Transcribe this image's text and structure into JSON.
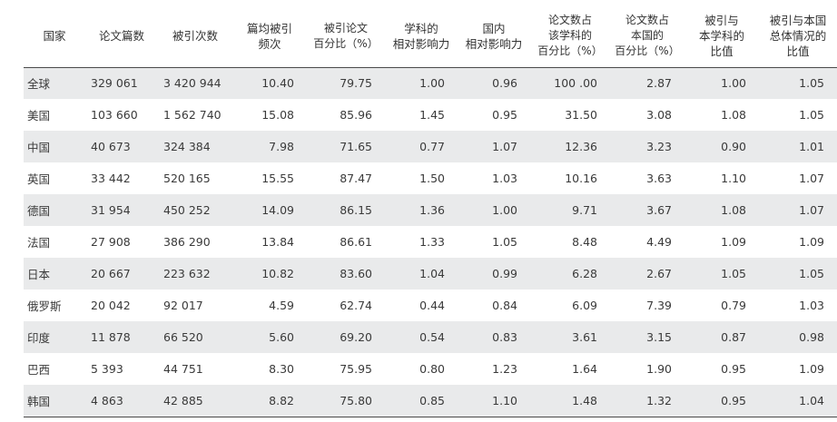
{
  "table": {
    "headers": [
      "国家",
      "论文篇数",
      "被引次数",
      "篇均被引\n频次",
      "被引论文\n百分比（%）",
      "学科的\n相对影响力",
      "国内\n相对影响力",
      "论文数占\n该学科的\n百分比（%）",
      "论文数占\n本国的\n百分比（%）",
      "被引与\n本学科的\n比值",
      "被引与本国\n总体情况的\n比值"
    ],
    "rows": [
      [
        "全球",
        "329 061",
        "3 420 944",
        "10.40",
        "79.75",
        "1.00",
        "0.96",
        "100 .00",
        "2.87",
        "1.00",
        "1.05"
      ],
      [
        "美国",
        "103 660",
        "1 562 740",
        "15.08",
        "85.96",
        "1.45",
        "0.95",
        "31.50",
        "3.08",
        "1.08",
        "1.05"
      ],
      [
        "中国",
        "40 673",
        "324 384",
        "7.98",
        "71.65",
        "0.77",
        "1.07",
        "12.36",
        "3.23",
        "0.90",
        "1.01"
      ],
      [
        "英国",
        "33 442",
        "520 165",
        "15.55",
        "87.47",
        "1.50",
        "1.03",
        "10.16",
        "3.63",
        "1.10",
        "1.07"
      ],
      [
        "德国",
        "31 954",
        "450 252",
        "14.09",
        "86.15",
        "1.36",
        "1.00",
        "9.71",
        "3.67",
        "1.08",
        "1.07"
      ],
      [
        "法国",
        "27 908",
        "386 290",
        "13.84",
        "86.61",
        "1.33",
        "1.05",
        "8.48",
        "4.49",
        "1.09",
        "1.09"
      ],
      [
        "日本",
        "20 667",
        "223 632",
        "10.82",
        "83.60",
        "1.04",
        "0.99",
        "6.28",
        "2.67",
        "1.05",
        "1.05"
      ],
      [
        "俄罗斯",
        "20 042",
        "92 017",
        "4.59",
        "62.74",
        "0.44",
        "0.84",
        "6.09",
        "7.39",
        "0.79",
        "1.03"
      ],
      [
        "印度",
        "11 878",
        "66 520",
        "5.60",
        "69.20",
        "0.54",
        "0.83",
        "3.61",
        "3.15",
        "0.87",
        "0.98"
      ],
      [
        "巴西",
        "5 393",
        "44 751",
        "8.30",
        "75.95",
        "0.80",
        "1.23",
        "1.64",
        "1.90",
        "0.95",
        "1.09"
      ],
      [
        "韩国",
        "4 863",
        "42 885",
        "8.82",
        "75.80",
        "0.85",
        "1.10",
        "1.48",
        "1.32",
        "0.95",
        "1.04"
      ]
    ]
  }
}
